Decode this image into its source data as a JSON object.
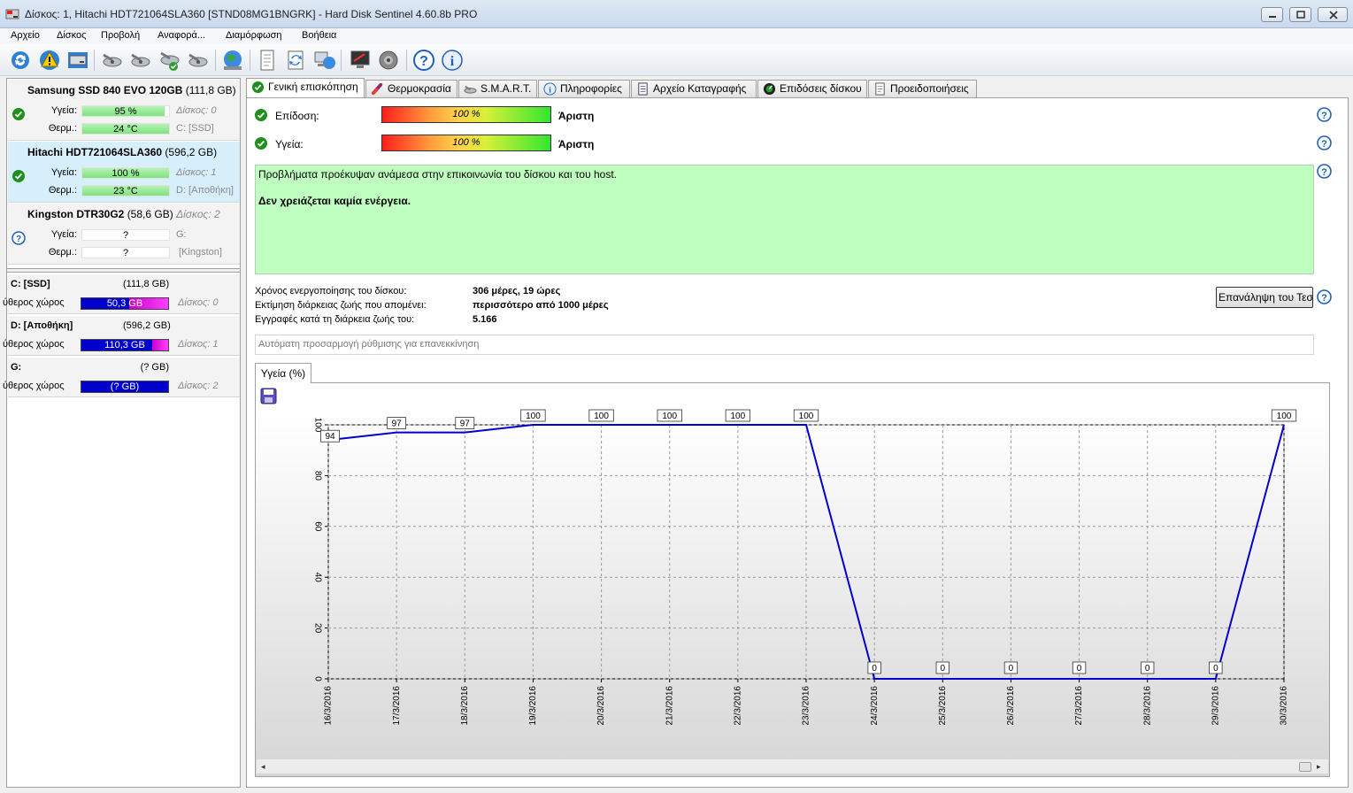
{
  "window": {
    "title": "Δίσκος: 1, Hitachi HDT721064SLA360 [STND08MG1BNGRK]  -  Hard Disk Sentinel 4.60.8b PRO"
  },
  "menu": [
    "Αρχείο",
    "Δίσκος",
    "Προβολή",
    "Αναφορά...",
    "Διαμόρφωση",
    "Βοήθεια"
  ],
  "toolbar": {
    "icons": [
      "refresh-icon",
      "alert-icon",
      "disk-report-icon",
      "disk-test-icon",
      "disk-test2-icon",
      "disk-ok-icon",
      "disk-tools-icon",
      "internet-icon",
      "document-icon",
      "exchange-icon",
      "network-icon",
      "monitor-icon",
      "speaker-icon",
      "help-icon",
      "info-icon"
    ]
  },
  "disks": [
    {
      "name": "Samsung SSD 840 EVO 120GB",
      "size": "(111,8 GB)",
      "status": "ok",
      "health_label": "Υγεία:",
      "health": "95 %",
      "health_fraction": 0.95,
      "temp_label": "Θερμ.:",
      "temp": "24 °C",
      "temp_fraction": 1.0,
      "disk_no": "Δίσκος: 0",
      "drive": "C: [SSD]"
    },
    {
      "name": "Hitachi HDT721064SLA360",
      "size": "(596,2 GB)",
      "status": "ok",
      "health_label": "Υγεία:",
      "health": "100 %",
      "health_fraction": 1.0,
      "temp_label": "Θερμ.:",
      "temp": "23 °C",
      "temp_fraction": 1.0,
      "disk_no": "Δίσκος: 1",
      "drive": "D: [Αποθήκη]"
    },
    {
      "name": "Kingston DTR30G2",
      "size": "(58,6 GB)",
      "status": "unknown",
      "health_label": "Υγεία:",
      "health": "?",
      "health_fraction": 0,
      "temp_label": "Θερμ.:",
      "temp": "?",
      "temp_fraction": 0,
      "disk_no": "Δίσκος: 2",
      "drive": "G:",
      "drive2": "[Kingston]"
    }
  ],
  "volumes": [
    {
      "name": "C: [SSD]",
      "size": "(111,8 GB)",
      "free_label": "ύθερος χώρος",
      "free": "50,3 GB",
      "free_fraction": 0.45,
      "disk_no": "Δίσκος: 0"
    },
    {
      "name": "D: [Αποθήκη]",
      "size": "(596,2 GB)",
      "free_label": "ύθερος χώρος",
      "free": "110,3 GB",
      "free_fraction": 0.18,
      "disk_no": "Δίσκος: 1"
    },
    {
      "name": "G:",
      "size": "(? GB)",
      "free_label": "ύθερος χώρος",
      "free": "(? GB)",
      "free_fraction": 0,
      "disk_no": "Δίσκος: 2"
    }
  ],
  "tabs": [
    {
      "label": "Γενική επισκόπηση",
      "icon": "check-icon",
      "active": true
    },
    {
      "label": "Θερμοκρασία",
      "icon": "thermometer-icon"
    },
    {
      "label": "S.M.A.R.T.",
      "icon": "smart-icon"
    },
    {
      "label": "Πληροφορίες",
      "icon": "info-icon"
    },
    {
      "label": "Αρχείο Καταγραφής",
      "icon": "log-icon"
    },
    {
      "label": "Επιδόσεις δίσκου",
      "icon": "gauge-icon"
    },
    {
      "label": "Προειδοποιήσεις",
      "icon": "warning-doc-icon"
    }
  ],
  "overview": {
    "performance_label": "Επίδοση:",
    "performance_value": "100 %",
    "performance_rating": "Άριστη",
    "health_label": "Υγεία:",
    "health_value": "100 %",
    "health_rating": "Άριστη",
    "message_line1": "Προβλήματα προέκυψαν ανάμεσα στην επικοινωνία του δίσκου και του host.",
    "message_line2": "Δεν χρειάζεται καμία ενέργεια.",
    "power_on_label": "Χρόνος ενεργοποίησης του δίσκου:",
    "power_on_value": "306 μέρες, 19 ώρες",
    "lifetime_label": "Εκτίμηση διάρκειας ζωής που απομένει:",
    "lifetime_value": "περισσότερο από 1000 μέρες",
    "writes_label": "Εγγραφές κατά τη διάρκεια ζωής του:",
    "writes_value": "5.166",
    "repeat_button": "Επανάληψη του Τεσ",
    "auto_adjust": "Αυτόματη προσαρμογή ρύθμισης για επανεκκίνηση",
    "chart_tab": "Υγεία (%)"
  },
  "chart_data": {
    "type": "line",
    "title": "",
    "xlabel": "",
    "ylabel": "",
    "x": [
      "16/3/2016",
      "17/3/2016",
      "18/3/2016",
      "19/3/2016",
      "20/3/2016",
      "21/3/2016",
      "22/3/2016",
      "23/3/2016",
      "24/3/2016",
      "25/3/2016",
      "26/3/2016",
      "27/3/2016",
      "28/3/2016",
      "29/3/2016",
      "30/3/2016"
    ],
    "series": [
      {
        "values": [
          94,
          97,
          97,
          100,
          100,
          100,
          100,
          100,
          0,
          0,
          0,
          0,
          0,
          0,
          100
        ]
      }
    ],
    "ylim": [
      0,
      100
    ],
    "yticks": [
      0,
      20,
      40,
      60,
      80,
      100
    ],
    "grid": true,
    "line_color": "#0000cc"
  }
}
